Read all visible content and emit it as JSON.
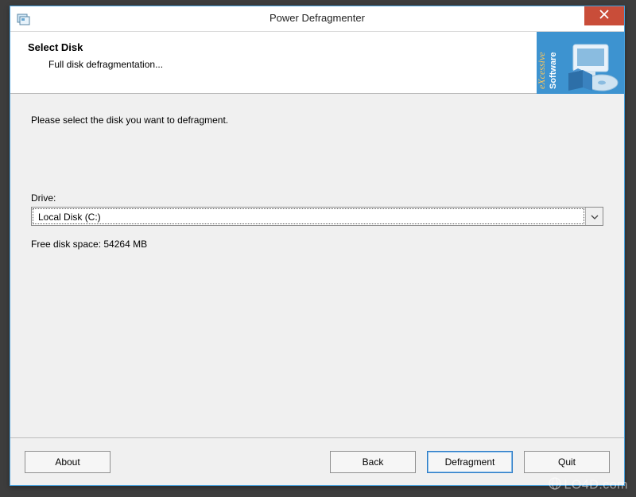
{
  "window": {
    "title": "Power Defragmenter"
  },
  "header": {
    "title": "Select Disk",
    "subtitle": "Full disk defragmentation...",
    "logo_brand": "eXcessive",
    "logo_word": "Software"
  },
  "content": {
    "instruction": "Please select the disk you want to defragment.",
    "drive_label": "Drive:",
    "drive_selected": "Local Disk (C:)",
    "free_space_text": "Free disk space: 54264 MB"
  },
  "buttons": {
    "about": "About",
    "back": "Back",
    "defragment": "Defragment",
    "quit": "Quit"
  },
  "watermark": "LO4D.com"
}
